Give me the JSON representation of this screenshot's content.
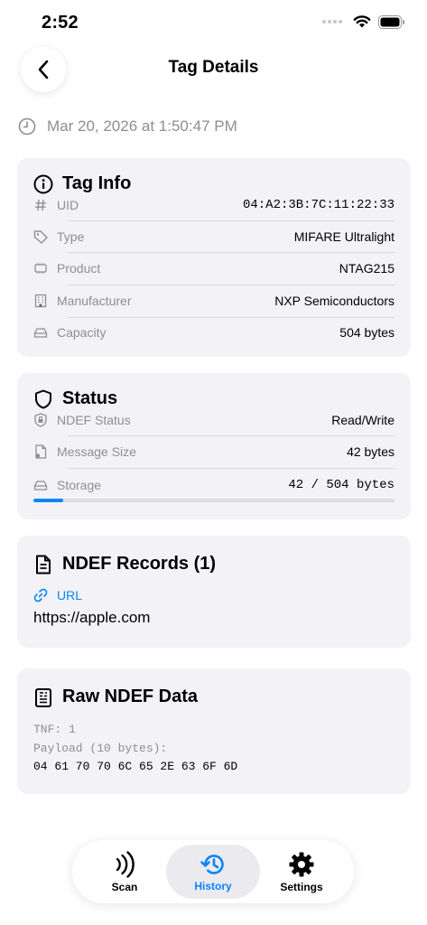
{
  "status_bar": {
    "time": "2:52"
  },
  "nav": {
    "title": "Tag Details"
  },
  "scan_date": "Mar 20, 2026 at 1:50:47 PM",
  "tag_info": {
    "title": "Tag Info",
    "rows": [
      {
        "label": "UID",
        "value": "04:A2:3B:7C:11:22:33",
        "icon": "hash-icon"
      },
      {
        "label": "Type",
        "value": "MIFARE Ultralight",
        "icon": "tag-icon"
      },
      {
        "label": "Product",
        "value": "NTAG215",
        "icon": "chip-icon"
      },
      {
        "label": "Manufacturer",
        "value": "NXP Semiconductors",
        "icon": "building-icon"
      },
      {
        "label": "Capacity",
        "value": "504 bytes",
        "icon": "drive-icon"
      }
    ]
  },
  "status": {
    "title": "Status",
    "rows": [
      {
        "label": "NDEF Status",
        "value": "Read/Write",
        "icon": "lock-shield-icon"
      },
      {
        "label": "Message Size",
        "value": "42 bytes",
        "icon": "document-icon"
      },
      {
        "label": "Storage",
        "value": "42 / 504 bytes",
        "icon": "drive-icon"
      }
    ],
    "storage_used_fraction": 0.083
  },
  "ndef_records": {
    "title": "NDEF Records (1)",
    "records": [
      {
        "type": "URL",
        "value": "https://apple.com"
      }
    ]
  },
  "raw_ndef": {
    "title": "Raw NDEF Data",
    "tnf": "TNF: 1",
    "payload_label": "Payload (10 bytes):",
    "payload_hex": "04 61 70 70 6C 65 2E 63 6F 6D"
  },
  "tabbar": {
    "tabs": [
      {
        "label": "Scan",
        "icon": "nfc-waves-icon",
        "active": false
      },
      {
        "label": "History",
        "icon": "history-icon",
        "active": true
      },
      {
        "label": "Settings",
        "icon": "gear-icon",
        "active": false
      }
    ]
  },
  "colors": {
    "accent": "#0a84ff",
    "card": "#f2f2f7",
    "secondary_text": "#8e8e93"
  }
}
